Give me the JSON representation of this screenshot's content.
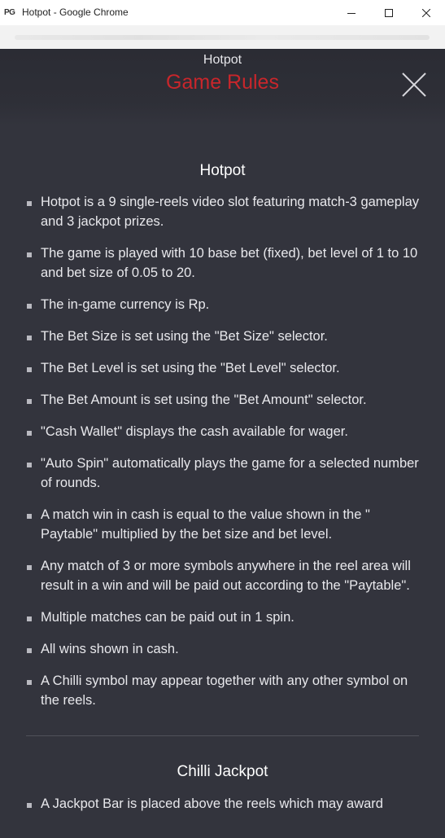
{
  "window": {
    "logo": "PG",
    "title": "Hotpot - Google Chrome"
  },
  "header": {
    "game_name": "Hotpot",
    "title": "Game Rules"
  },
  "sections": [
    {
      "title": "Hotpot",
      "items": [
        "Hotpot is a 9 single-reels video slot featuring match-3 gameplay and 3 jackpot prizes.",
        "The game is played with 10 base bet (fixed), bet level of 1 to 10 and bet size of 0.05 to 20.",
        "The in-game currency is Rp.",
        "The Bet Size is set using the \"Bet Size\" selector.",
        "The Bet Level is set using the \"Bet Level\" selector.",
        "The Bet Amount is set using the \"Bet Amount\" selector.",
        "\"Cash Wallet\" displays the cash available for wager.",
        "\"Auto Spin\" automatically plays the game for a selected number of rounds.",
        "A match win in cash is equal to the value shown in the \" Paytable\" multiplied by the bet size and bet level.",
        "Any match of 3 or more symbols anywhere in the reel area will result in a win and will be paid out according to the \"Paytable\".",
        "Multiple matches can be paid out in 1 spin.",
        "All wins shown in cash.",
        "A Chilli symbol may appear together with any other symbol on the reels."
      ]
    },
    {
      "title": "Chilli Jackpot",
      "items": [
        "A Jackpot Bar is placed above the reels which may award"
      ]
    }
  ],
  "colors": {
    "background": "#33343d",
    "accent": "#c8262b"
  },
  "icons": {
    "minimize": "minimize-icon",
    "maximize": "maximize-icon",
    "close_window": "close-window-icon",
    "close_rules": "close-icon"
  }
}
